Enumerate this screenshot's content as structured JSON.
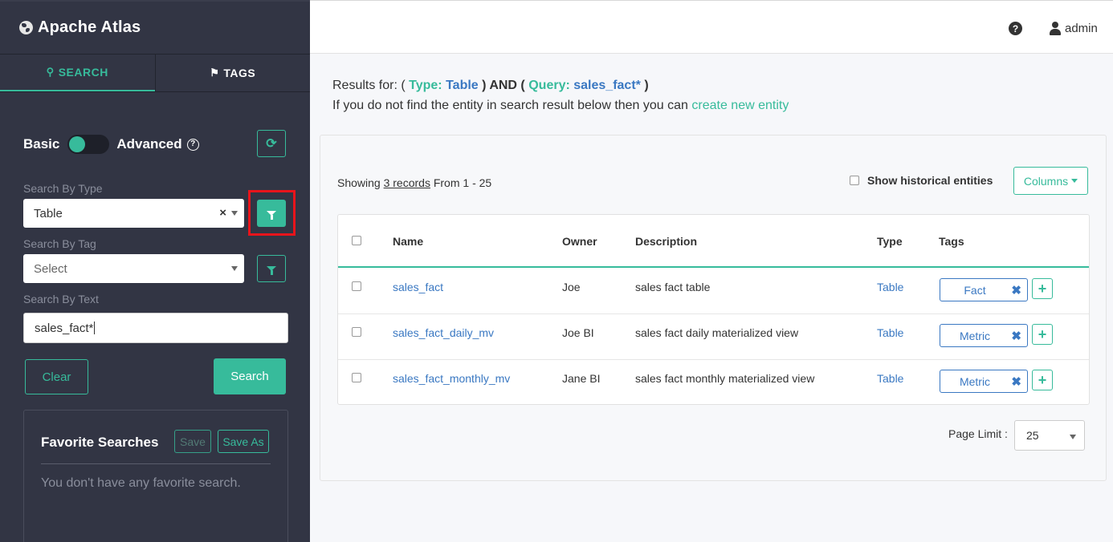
{
  "app": {
    "title": "Apache Atlas"
  },
  "sidebar": {
    "tabs": [
      {
        "label": "SEARCH",
        "icon": "search-icon",
        "active": true
      },
      {
        "label": "TAGS",
        "icon": "tags-icon",
        "active": false
      }
    ],
    "mode": {
      "basic_label": "Basic",
      "advanced_label": "Advanced"
    },
    "search_by_type": {
      "label": "Search By Type",
      "value": "Table"
    },
    "search_by_tag": {
      "label": "Search By Tag",
      "placeholder": "Select"
    },
    "search_by_text": {
      "label": "Search By Text",
      "value": "sales_fact*"
    },
    "clear_label": "Clear",
    "search_label": "Search",
    "favorites": {
      "title": "Favorite Searches",
      "save_label": "Save",
      "save_as_label": "Save As",
      "empty_text": "You don't have any favorite search."
    }
  },
  "header": {
    "user": "admin"
  },
  "results": {
    "prefix": "Results for: (",
    "type_key": "Type:",
    "type_value": "Table",
    "and_text": ") AND (",
    "query_key": "Query:",
    "query_value": "sales_fact*",
    "suffix": ")",
    "hint_text": "If you do not find the entity in search result below then you can",
    "hint_link": "create new entity"
  },
  "table_panel": {
    "showing_prefix": "Showing",
    "showing_count": "3 records",
    "showing_suffix": "From 1 - 25",
    "historical_label": "Show historical entities",
    "columns_label": "Columns",
    "headers": {
      "name": "Name",
      "owner": "Owner",
      "description": "Description",
      "type": "Type",
      "tags": "Tags"
    },
    "rows": [
      {
        "name": "sales_fact",
        "owner": "Joe",
        "description": "sales fact table",
        "type": "Table",
        "tag": "Fact"
      },
      {
        "name": "sales_fact_daily_mv",
        "owner": "Joe BI",
        "description": "sales fact daily materialized view",
        "type": "Table",
        "tag": "Metric"
      },
      {
        "name": "sales_fact_monthly_mv",
        "owner": "Jane BI",
        "description": "sales fact monthly materialized view",
        "type": "Table",
        "tag": "Metric"
      }
    ],
    "page_limit_label": "Page Limit :",
    "page_limit_value": "25"
  },
  "colors": {
    "accent": "#37bb9b",
    "link": "#3a78c2",
    "sidebar_bg": "#323544",
    "highlight": "#e8141b"
  }
}
